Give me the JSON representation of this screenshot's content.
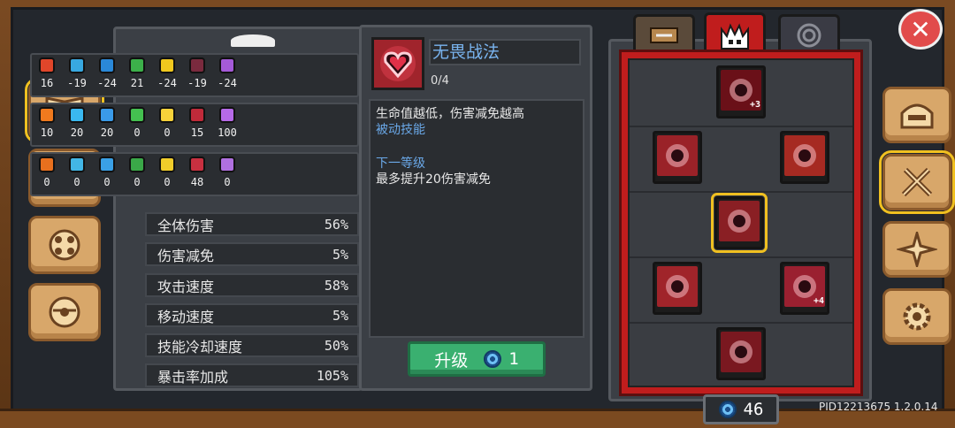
{
  "element_stats": {
    "row1": [
      {
        "icon": "fire-shield-icon",
        "color": "#e0462a",
        "value": "16"
      },
      {
        "icon": "ice-shield-icon",
        "color": "#38a8e0",
        "value": "-19"
      },
      {
        "icon": "lightning-shield-icon",
        "color": "#2a88d8",
        "value": "-24"
      },
      {
        "icon": "poison-shield-icon",
        "color": "#3cb04a",
        "value": "21"
      },
      {
        "icon": "light-shield-icon",
        "color": "#f0c81e",
        "value": "-24"
      },
      {
        "icon": "dark-shield-icon",
        "color": "#7a2a3e",
        "value": "-19"
      },
      {
        "icon": "arcane-shield-icon",
        "color": "#a45ad8",
        "value": "-24"
      }
    ],
    "row2": [
      {
        "icon": "fire-icon",
        "color": "#f07a1e",
        "value": "10"
      },
      {
        "icon": "ice-crystal-icon",
        "color": "#3ab8f0",
        "value": "20"
      },
      {
        "icon": "lightning-icon",
        "color": "#3a9ae8",
        "value": "20"
      },
      {
        "icon": "poison-skull-icon",
        "color": "#44c050",
        "value": "0"
      },
      {
        "icon": "sun-icon",
        "color": "#f7d23a",
        "value": "0"
      },
      {
        "icon": "dark-moon-icon",
        "color": "#c02a3a",
        "value": "15"
      },
      {
        "icon": "arcane-star-icon",
        "color": "#b66ae8",
        "value": "100"
      }
    ],
    "row3": [
      {
        "icon": "fire-sword-icon",
        "color": "#e8701e",
        "value": "0"
      },
      {
        "icon": "ice-sword-icon",
        "color": "#42b6e6",
        "value": "0"
      },
      {
        "icon": "lightning-sword-icon",
        "color": "#3aa0e6",
        "value": "0"
      },
      {
        "icon": "poison-sword-icon",
        "color": "#3aa848",
        "value": "0"
      },
      {
        "icon": "light-sword-icon",
        "color": "#f0cc2a",
        "value": "0"
      },
      {
        "icon": "dark-sword-icon",
        "color": "#c83040",
        "value": "48"
      },
      {
        "icon": "arcane-sword-icon",
        "color": "#b070e0",
        "value": "0"
      }
    ]
  },
  "stats": [
    {
      "label": "全体伤害",
      "value": "56%"
    },
    {
      "label": "伤害减免",
      "value": "5%"
    },
    {
      "label": "攻击速度",
      "value": "58%"
    },
    {
      "label": "移动速度",
      "value": "5%"
    },
    {
      "label": "技能冷却速度",
      "value": "50%"
    },
    {
      "label": "暴击率加成",
      "value": "105%"
    }
  ],
  "skill": {
    "name": "无畏战法",
    "level": "0/4",
    "desc_line1": "生命值越低，伤害减免越高",
    "desc_type": "被动技能",
    "next_level_title": "下一等级",
    "next_level_desc": "最多提升20伤害减免"
  },
  "upgrade": {
    "label": "升级",
    "cost": "1"
  },
  "tree": {
    "nodes": [
      {
        "name": "skill-node-skull-burst",
        "badge": "+3"
      },
      {
        "name": "skill-node-blood-orbs",
        "badge": ""
      },
      {
        "name": "skill-node-blood-drill",
        "badge": ""
      },
      {
        "name": "skill-node-fearless-heart",
        "badge": ""
      },
      {
        "name": "skill-node-blood-axe",
        "badge": ""
      },
      {
        "name": "skill-node-rage-burst",
        "badge": "+4"
      },
      {
        "name": "skill-node-blood-vortex",
        "badge": ""
      }
    ]
  },
  "currency": {
    "value": "46"
  },
  "footer": {
    "pid": "PID12213675 1.2.0.14"
  },
  "colors": {
    "wood": "#7a4a22",
    "menu_button": "#d8a76a",
    "tree_red": "#c01d1d",
    "upgrade_green": "#3ab070",
    "skill_name_blue": "#79b4ef",
    "selected_outline": "#f0c020"
  }
}
